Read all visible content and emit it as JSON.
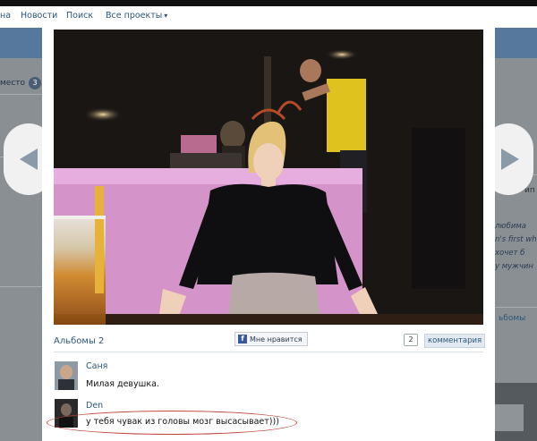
{
  "nav": {
    "item_cut": "на",
    "news": "Новости",
    "search": "Поиск",
    "all_projects": "Все проекты"
  },
  "background": {
    "left_text": "место",
    "left_badge": "3",
    "right_heading": "ип",
    "right_lines": [
      "любима",
      "n's first wh",
      "хочет б",
      "у мужчин"
    ],
    "right_link": "ьбомы"
  },
  "lightbox": {
    "albums_label": "Альбомы 2",
    "like_label": "Мне нравится",
    "comments_count": "2",
    "comments_label": "комментария",
    "comments": [
      {
        "author": "Саня",
        "text": "Милая девушка."
      },
      {
        "author": "Den",
        "text": "у тебя чувак из головы мозг высасывает)))"
      }
    ]
  },
  "colors": {
    "link": "#2b587a",
    "header_blue": "#56789c",
    "highlight_oval": "#c4463e"
  },
  "icons": [
    "chevron-down-icon",
    "arrow-left-icon",
    "arrow-right-icon",
    "facebook-icon"
  ]
}
